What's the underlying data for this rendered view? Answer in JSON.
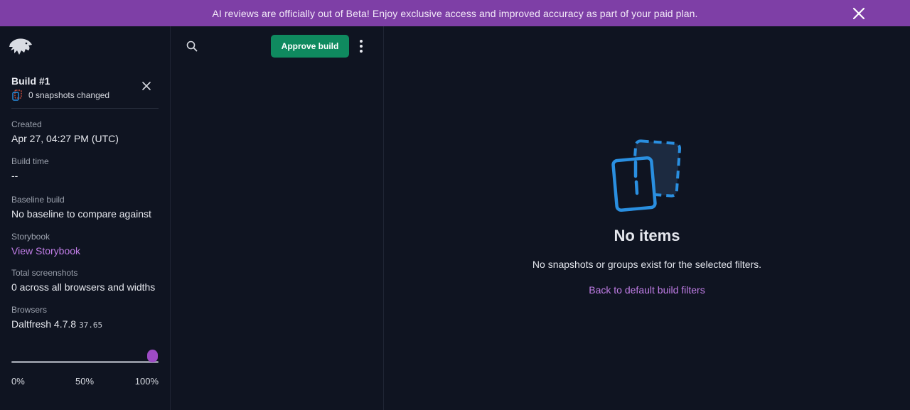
{
  "banner": {
    "text": "AI reviews are officially out of Beta! Enjoy exclusive access and improved accuracy as part of your paid plan."
  },
  "sidebar": {
    "build_title": "Build #1",
    "build_subtitle": "0 snapshots changed",
    "meta": [
      {
        "label": "Created",
        "value": "Apr 27, 04:27 PM (UTC)"
      },
      {
        "label": "Build time",
        "value": "--"
      },
      {
        "label": "Baseline build",
        "value": "No baseline to compare against"
      },
      {
        "label": "Storybook",
        "value": "View Storybook"
      },
      {
        "label": "Total screenshots",
        "value": "0 across all browsers and widths"
      },
      {
        "label": "Browsers",
        "value": "Daltfresh 4.7.8",
        "value_extra": "37.65"
      }
    ],
    "slider": {
      "value_fraction": 1.0,
      "labels": [
        "0%",
        "50%",
        "100%"
      ]
    }
  },
  "list": {
    "approve_label": "Approve build"
  },
  "main": {
    "empty_title": "No items",
    "empty_description": "No snapshots or groups exist for the selected filters.",
    "empty_link": "Back to default build filters"
  },
  "colors": {
    "banner": "#7e3fa6",
    "background": "#0f1421",
    "approve": "#0f8a5f",
    "link": "#c27ee8",
    "accent_blue": "#2a8fe0",
    "slider_thumb": "#9d4bc5"
  },
  "icons": {
    "banner_close": "close-icon",
    "logo": "eagle-logo",
    "snapshots": "snapshots-icon",
    "build_close": "close-icon",
    "search": "search-icon",
    "more": "more-vertical-icon",
    "empty": "empty-snapshots-illustration"
  }
}
